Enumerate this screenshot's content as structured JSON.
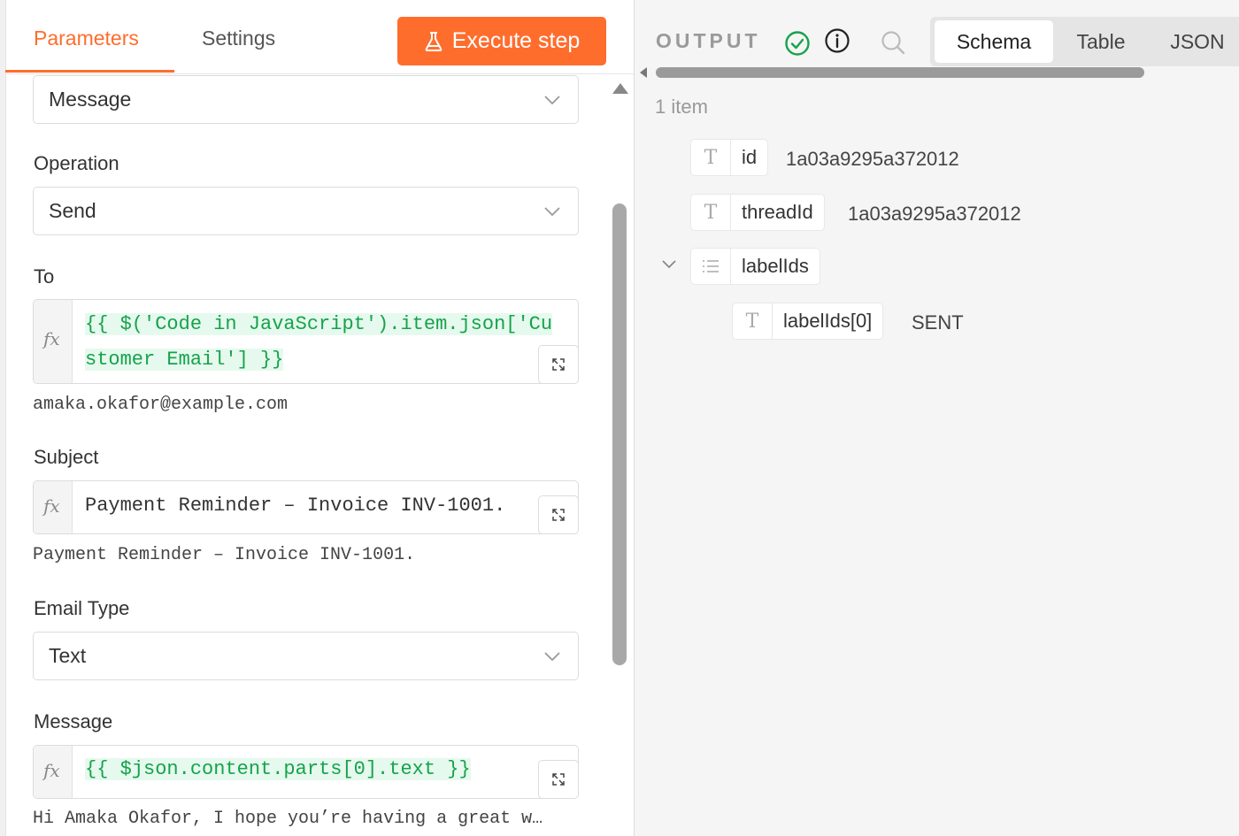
{
  "tabs": {
    "parameters": "Parameters",
    "settings": "Settings"
  },
  "execute_button": "Execute step",
  "fields": {
    "resource": {
      "value": "Message"
    },
    "operation": {
      "label": "Operation",
      "value": "Send"
    },
    "to": {
      "label": "To",
      "expr_line1": "{{ $('Code in JavaScript').item.json['Cu",
      "expr_line2": "stomer Email'] }}",
      "preview": "amaka.okafor@example.com"
    },
    "subject": {
      "label": "Subject",
      "expr": "Payment Reminder – Invoice INV-1001.",
      "preview": "Payment Reminder – Invoice INV-1001."
    },
    "email_type": {
      "label": "Email Type",
      "value": "Text"
    },
    "message": {
      "label": "Message",
      "expr": "{{ $json.content.parts[0].text }}",
      "preview": "Hi Amaka Okafor, I hope you’re having a great w…"
    },
    "fx_symbol": "fx"
  },
  "output": {
    "label": "OUTPUT",
    "views": {
      "schema": "Schema",
      "table": "Table",
      "json": "JSON"
    },
    "item_count": "1 item",
    "rows": [
      {
        "type_icon": "T",
        "key": "id",
        "value": "1a03a9295a372012"
      },
      {
        "type_icon": "T",
        "key": "threadId",
        "value": "1a03a9295a372012"
      },
      {
        "type_icon": "list",
        "key": "labelIds",
        "value": ""
      },
      {
        "type_icon": "T",
        "key": "labelIds[0]",
        "value": "SENT"
      }
    ]
  },
  "colors": {
    "accent": "#ff6d2d",
    "success": "#15a34a",
    "expression_bg": "#e6f9ee"
  }
}
